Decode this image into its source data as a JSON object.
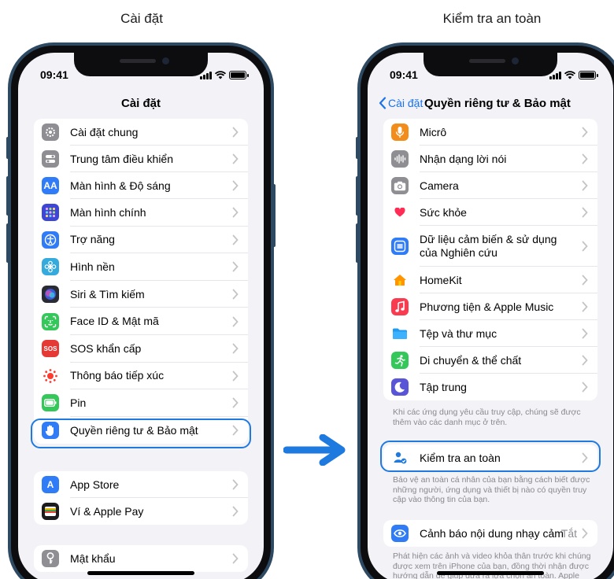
{
  "captions": {
    "left": "Cài đặt",
    "right": "Kiểm tra an toàn"
  },
  "left_phone": {
    "time": "09:41",
    "nav_title": "Cài đặt",
    "group1": [
      {
        "label": "Cài đặt chung",
        "icon": "gear-icon",
        "color": "#8e8e93"
      },
      {
        "label": "Trung tâm điều khiển",
        "icon": "control-center-icon",
        "color": "#8e8e93"
      },
      {
        "label": "Màn hình & Độ sáng",
        "icon": "display-icon",
        "color": "#2f7cf6",
        "glyph": "AA"
      },
      {
        "label": "Màn hình chính",
        "icon": "home-screen-icon",
        "color": "#3e46d6"
      },
      {
        "label": "Trợ năng",
        "icon": "accessibility-icon",
        "color": "#2f7cf6"
      },
      {
        "label": "Hình nền",
        "icon": "wallpaper-icon",
        "color": "#35aadc"
      },
      {
        "label": "Siri & Tìm kiếm",
        "icon": "siri-icon",
        "color": "#2b2b33"
      },
      {
        "label": "Face ID & Mật mã",
        "icon": "face-id-icon",
        "color": "#34c759"
      },
      {
        "label": "SOS khẩn cấp",
        "icon": "sos-icon",
        "color": "#e53935",
        "glyph": "SOS"
      },
      {
        "label": "Thông báo tiếp xúc",
        "icon": "exposure-icon",
        "color": "#ffffff"
      },
      {
        "label": "Pin",
        "icon": "battery-icon",
        "color": "#34c759"
      },
      {
        "label": "Quyền riêng tư & Bảo mật",
        "icon": "hand-icon",
        "color": "#2f7cf6"
      }
    ],
    "group2": [
      {
        "label": "App Store",
        "icon": "app-store-icon",
        "color": "#2f7cf6",
        "glyph": "A"
      },
      {
        "label": "Ví & Apple Pay",
        "icon": "wallet-icon",
        "color": "#1c1c1e"
      }
    ],
    "group3": [
      {
        "label": "Mật khẩu",
        "icon": "key-icon",
        "color": "#8e8e93"
      }
    ]
  },
  "right_phone": {
    "time": "09:41",
    "back_label": "Cài đặt",
    "nav_title": "Quyền riêng tư & Bảo mật",
    "group1": [
      {
        "label": "Micrô",
        "icon": "microphone-icon",
        "color": "#f28c1b"
      },
      {
        "label": "Nhận dạng lời nói",
        "icon": "speech-icon",
        "color": "#8e8e93"
      },
      {
        "label": "Camera",
        "icon": "camera-icon",
        "color": "#8e8e93"
      },
      {
        "label": "Sức khỏe",
        "icon": "heart-icon",
        "color": "#ffffff"
      },
      {
        "label": "Dữ liệu cảm biến & sử dụng của Nghiên cứu",
        "icon": "research-icon",
        "color": "#2f7cf6"
      },
      {
        "label": "HomeKit",
        "icon": "homekit-icon",
        "color": "#ffffff"
      },
      {
        "label": "Phương tiện & Apple Music",
        "icon": "music-icon",
        "color": "#fa3a4f"
      },
      {
        "label": "Tệp và thư mục",
        "icon": "folder-icon",
        "color": "#ffffff"
      },
      {
        "label": "Di chuyển & thể chất",
        "icon": "fitness-icon",
        "color": "#34c759"
      },
      {
        "label": "Tập trung",
        "icon": "focus-icon",
        "color": "#5856d6"
      }
    ],
    "footnote1": "Khi các ứng dụng yêu cầu truy cập, chúng sẽ được thêm vào các danh mục ở trên.",
    "safety_label": "Kiểm tra an toàn",
    "footnote2": "Bảo vệ an toàn cá nhân của bạn bằng cách biết được những người, ứng dụng và thiết bị nào có quyền truy cập vào thông tin của bạn.",
    "sensitive_label": "Cảnh báo nội dung nhạy cảm",
    "sensitive_value": "Tắt",
    "footnote3": "Phát hiện các ảnh và video khỏa thân trước khi chúng được xem trên iPhone của bạn, đồng thời nhận được hướng dẫn để giúp đưa ra lựa chọn an toàn. Apple"
  },
  "colors": {
    "accent": "#1f7ae0",
    "arrow": "#1f7ae0"
  }
}
